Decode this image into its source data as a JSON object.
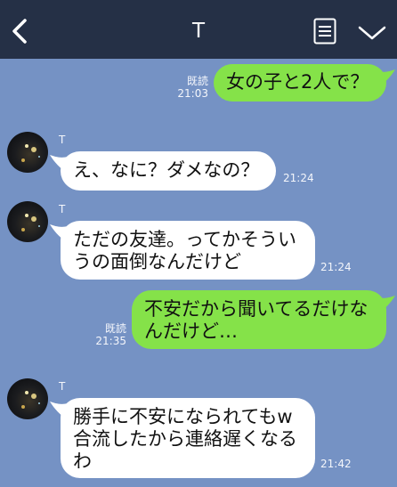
{
  "header": {
    "title": "T"
  },
  "messages": [
    {
      "direction": "outgoing",
      "text": "女の子と2人で？",
      "read": "既読",
      "time": "21:03"
    },
    {
      "direction": "incoming",
      "sender": "T",
      "text": "え、なに？ダメなの？",
      "time": "21:24"
    },
    {
      "direction": "incoming",
      "sender": "T",
      "text_lines": [
        "ただの友達。ってかそうい",
        "うの面倒なんだけど"
      ],
      "time": "21:24"
    },
    {
      "direction": "outgoing",
      "text_lines": [
        "不安だから聞いてるだけな",
        "んだけど…"
      ],
      "read": "既読",
      "time": "21:35"
    },
    {
      "direction": "incoming",
      "sender": "T",
      "text_lines": [
        "勝手に不安になられてもw",
        "合流したから連絡遅くなる",
        "わ"
      ],
      "time": "21:42"
    }
  ],
  "colors": {
    "chat_background": "#7592c4",
    "header_background": "#253046",
    "outgoing_bubble": "#85e249",
    "incoming_bubble": "#ffffff"
  }
}
